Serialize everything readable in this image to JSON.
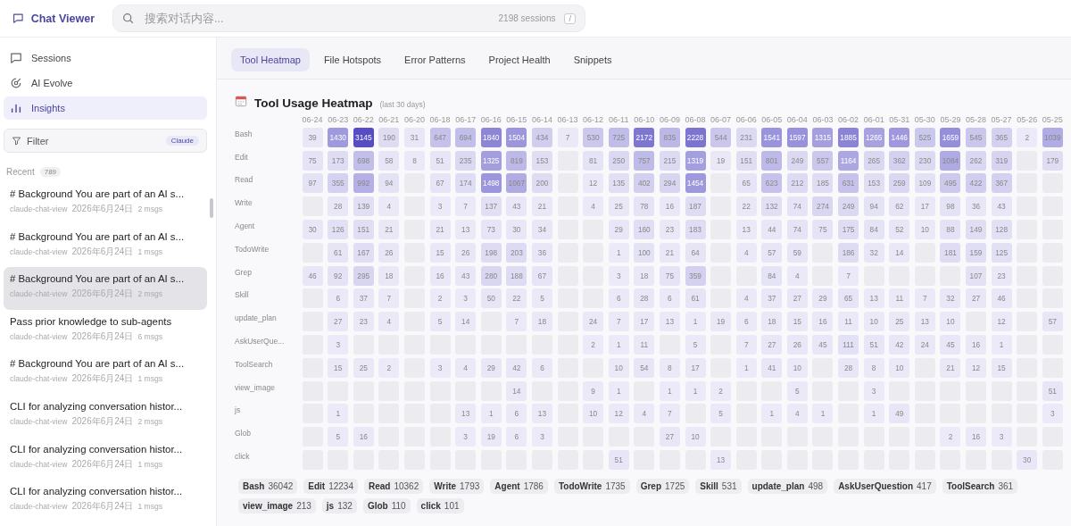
{
  "app": {
    "title": "Chat Viewer"
  },
  "search": {
    "placeholder": "搜索对话内容...",
    "count": "2198 sessions",
    "shortcut": "/"
  },
  "nav": [
    {
      "label": "Sessions",
      "kind": "chat",
      "selected": false
    },
    {
      "label": "AI Evolve",
      "kind": "evolve",
      "selected": false
    },
    {
      "label": "Insights",
      "kind": "chart",
      "selected": true
    }
  ],
  "filter": {
    "label": "Filter",
    "badge": "Claude"
  },
  "recent": {
    "label": "Recent",
    "count": "789"
  },
  "sessions": [
    {
      "title": "# Background You are part of an AI s...",
      "project": "claude-chat-view",
      "date": "2026年6月24日",
      "msgs": "2 msgs",
      "selected": false
    },
    {
      "title": "# Background You are part of an AI s...",
      "project": "claude-chat-view",
      "date": "2026年6月24日",
      "msgs": "1 msgs",
      "selected": false
    },
    {
      "title": "# Background You are part of an AI s...",
      "project": "claude-chat-view",
      "date": "2026年6月24日",
      "msgs": "2 msgs",
      "selected": true
    },
    {
      "title": "Pass prior knowledge to sub-agents",
      "project": "claude-chat-view",
      "date": "2026年6月24日",
      "msgs": "6 msgs",
      "selected": false
    },
    {
      "title": "# Background You are part of an AI s...",
      "project": "claude-chat-view",
      "date": "2026年6月24日",
      "msgs": "1 msgs",
      "selected": false
    },
    {
      "title": "CLI for analyzing conversation histor...",
      "project": "claude-chat-view",
      "date": "2026年6月24日",
      "msgs": "2 msgs",
      "selected": false
    },
    {
      "title": "CLI for analyzing conversation histor...",
      "project": "claude-chat-view",
      "date": "2026年6月24日",
      "msgs": "1 msgs",
      "selected": false
    },
    {
      "title": "CLI for analyzing conversation histor...",
      "project": "claude-chat-view",
      "date": "2026年6月24日",
      "msgs": "1 msgs",
      "selected": false
    }
  ],
  "tabs": [
    {
      "label": "Tool Heatmap",
      "selected": true
    },
    {
      "label": "File Hotspots",
      "selected": false
    },
    {
      "label": "Error Patterns",
      "selected": false
    },
    {
      "label": "Project Health",
      "selected": false
    },
    {
      "label": "Snippets",
      "selected": false
    }
  ],
  "heatmap": {
    "title": "Tool Usage Heatmap",
    "subtitle": "(last 30 days)",
    "dates": [
      "06-24",
      "06-23",
      "06-22",
      "06-21",
      "06-20",
      "06-18",
      "06-17",
      "06-16",
      "06-15",
      "06-14",
      "06-13",
      "06-12",
      "06-11",
      "06-10",
      "06-09",
      "06-08",
      "06-07",
      "06-06",
      "06-05",
      "06-04",
      "06-03",
      "06-02",
      "06-01",
      "05-31",
      "05-30",
      "05-29",
      "05-28",
      "05-27",
      "05-26",
      "05-25"
    ],
    "rows": [
      {
        "tool": "Bash",
        "cells": [
          "39",
          "1430",
          "3145",
          "190",
          "31",
          "647",
          "694",
          "1840",
          "1504",
          "434",
          "7",
          "530",
          "725",
          "2172",
          "835",
          "2228",
          "544",
          "231",
          "1541",
          "1597",
          "1315",
          "1885",
          "1265",
          "1446",
          "525",
          "1659",
          "545",
          "365",
          "2",
          "1039"
        ]
      },
      {
        "tool": "Edit",
        "cells": [
          "75",
          "173",
          "698",
          "58",
          "8",
          "51",
          "235",
          "1325",
          "819",
          "153",
          null,
          "81",
          "250",
          "757",
          "215",
          "1319",
          "19",
          "151",
          "801",
          "249",
          "557",
          "1164",
          "265",
          "362",
          "230",
          "1084",
          "262",
          "319",
          null,
          "179"
        ]
      },
      {
        "tool": "Read",
        "cells": [
          "97",
          "355",
          "992",
          "94",
          null,
          "67",
          "174",
          "1498",
          "1067",
          "200",
          null,
          "12",
          "135",
          "402",
          "294",
          "1454",
          null,
          "65",
          "623",
          "212",
          "185",
          "631",
          "153",
          "259",
          "109",
          "495",
          "422",
          "367",
          null,
          null
        ]
      },
      {
        "tool": "Write",
        "cells": [
          null,
          "28",
          "139",
          "4",
          null,
          "3",
          "7",
          "137",
          "43",
          "21",
          null,
          "4",
          "25",
          "78",
          "16",
          "187",
          null,
          "22",
          "132",
          "74",
          "274",
          "249",
          "94",
          "62",
          "17",
          "98",
          "36",
          "43",
          null,
          null
        ]
      },
      {
        "tool": "Agent",
        "cells": [
          "30",
          "126",
          "151",
          "21",
          null,
          "21",
          "13",
          "73",
          "30",
          "34",
          null,
          null,
          "29",
          "160",
          "23",
          "183",
          null,
          "13",
          "44",
          "74",
          "75",
          "175",
          "84",
          "52",
          "10",
          "88",
          "149",
          "128",
          null,
          null
        ]
      },
      {
        "tool": "TodoWrite",
        "cells": [
          null,
          "61",
          "167",
          "26",
          null,
          "15",
          "26",
          "198",
          "203",
          "36",
          null,
          null,
          "1",
          "100",
          "21",
          "64",
          null,
          "4",
          "57",
          "59",
          null,
          "186",
          "32",
          "14",
          null,
          "181",
          "159",
          "125",
          null,
          null
        ]
      },
      {
        "tool": "Grep",
        "cells": [
          "46",
          "92",
          "295",
          "18",
          null,
          "16",
          "43",
          "280",
          "188",
          "67",
          null,
          null,
          "3",
          "18",
          "75",
          "359",
          null,
          null,
          "84",
          "4",
          null,
          "7",
          null,
          null,
          null,
          null,
          "107",
          "23",
          null,
          null
        ]
      },
      {
        "tool": "Skill",
        "cells": [
          null,
          "6",
          "37",
          "7",
          null,
          "2",
          "3",
          "50",
          "22",
          "5",
          null,
          null,
          "6",
          "28",
          "6",
          "61",
          null,
          "4",
          "37",
          "27",
          "29",
          "65",
          "13",
          "11",
          "7",
          "32",
          "27",
          "46",
          null,
          null
        ]
      },
      {
        "tool": "update_plan",
        "cells": [
          null,
          "27",
          "23",
          "4",
          null,
          "5",
          "14",
          null,
          "7",
          "18",
          null,
          "24",
          "7",
          "17",
          "13",
          "1",
          "19",
          "6",
          "18",
          "15",
          "16",
          "11",
          "10",
          "25",
          "13",
          "10",
          null,
          "12",
          null,
          "57"
        ]
      },
      {
        "tool": "AskUserQue...",
        "cells": [
          null,
          "3",
          null,
          null,
          null,
          null,
          null,
          null,
          null,
          null,
          null,
          "2",
          "1",
          "11",
          null,
          "5",
          null,
          "7",
          "27",
          "26",
          "45",
          "111",
          "51",
          "42",
          "24",
          "45",
          "16",
          "1",
          null,
          null
        ]
      },
      {
        "tool": "ToolSearch",
        "cells": [
          null,
          "15",
          "25",
          "2",
          null,
          "3",
          "4",
          "29",
          "42",
          "6",
          null,
          null,
          "10",
          "54",
          "8",
          "17",
          null,
          "1",
          "41",
          "10",
          null,
          "28",
          "8",
          "10",
          null,
          "21",
          "12",
          "15",
          null,
          null
        ]
      },
      {
        "tool": "view_image",
        "cells": [
          null,
          null,
          null,
          null,
          null,
          null,
          null,
          null,
          "14",
          null,
          null,
          "9",
          "1",
          null,
          "1",
          "1",
          "2",
          null,
          null,
          "5",
          null,
          null,
          "3",
          null,
          null,
          null,
          null,
          null,
          null,
          "51"
        ]
      },
      {
        "tool": "js",
        "cells": [
          null,
          "1",
          null,
          null,
          null,
          null,
          "13",
          "1",
          "6",
          "13",
          null,
          "10",
          "12",
          "4",
          "7",
          null,
          "5",
          null,
          "1",
          "4",
          "1",
          null,
          "1",
          "49",
          null,
          null,
          null,
          null,
          null,
          "3"
        ]
      },
      {
        "tool": "Glob",
        "cells": [
          null,
          "5",
          "16",
          null,
          null,
          null,
          "3",
          "19",
          "6",
          "3",
          null,
          null,
          null,
          null,
          "27",
          "10",
          null,
          null,
          null,
          null,
          null,
          null,
          null,
          null,
          null,
          "2",
          "16",
          "3",
          null,
          null
        ]
      },
      {
        "tool": "click",
        "cells": [
          null,
          null,
          null,
          null,
          null,
          null,
          null,
          null,
          null,
          null,
          null,
          null,
          "51",
          null,
          null,
          null,
          "13",
          null,
          null,
          null,
          null,
          null,
          null,
          null,
          null,
          null,
          null,
          null,
          "30",
          null
        ]
      }
    ]
  },
  "totals": [
    {
      "tool": "Bash",
      "count": "36042"
    },
    {
      "tool": "Edit",
      "count": "12234"
    },
    {
      "tool": "Read",
      "count": "10362"
    },
    {
      "tool": "Write",
      "count": "1793"
    },
    {
      "tool": "Agent",
      "count": "1786"
    },
    {
      "tool": "TodoWrite",
      "count": "1735"
    },
    {
      "tool": "Grep",
      "count": "1725"
    },
    {
      "tool": "Skill",
      "count": "531"
    },
    {
      "tool": "update_plan",
      "count": "498"
    },
    {
      "tool": "AskUserQuestion",
      "count": "417"
    },
    {
      "tool": "ToolSearch",
      "count": "361"
    },
    {
      "tool": "view_image",
      "count": "213"
    },
    {
      "tool": "js",
      "count": "132"
    },
    {
      "tool": "Glob",
      "count": "110"
    },
    {
      "tool": "click",
      "count": "101"
    }
  ]
}
